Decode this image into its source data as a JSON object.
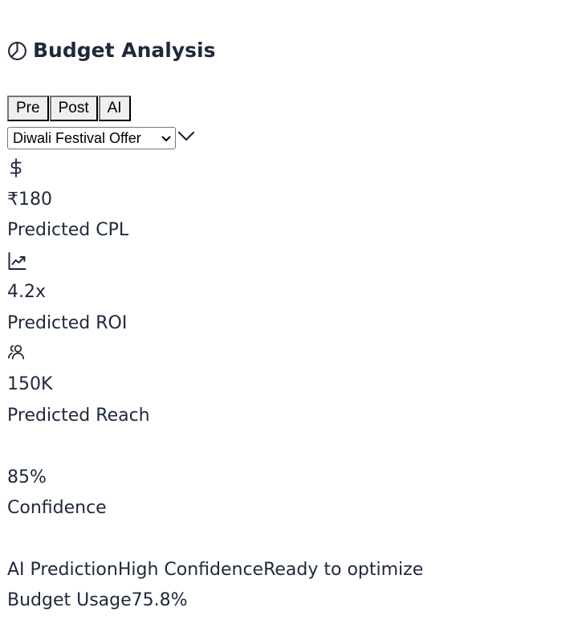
{
  "header": {
    "title": "Budget Analysis",
    "icon": "pie-chart-icon"
  },
  "tabs": [
    {
      "label": "Pre"
    },
    {
      "label": "Post"
    },
    {
      "label": "AI"
    }
  ],
  "campaign_select": {
    "selected": "Diwali Festival Offer"
  },
  "metrics": {
    "cpl": {
      "icon": "dollar-icon",
      "value": "₹180",
      "label": "Predicted CPL"
    },
    "roi": {
      "icon": "trending-up-icon",
      "value": "4.2x",
      "label": "Predicted ROI"
    },
    "reach": {
      "icon": "users-icon",
      "value": "150K",
      "label": "Predicted Reach"
    },
    "confidence": {
      "value": "85%",
      "label": "Confidence"
    }
  },
  "status_line": {
    "prediction": "AI Prediction",
    "confidence": "High Confidence",
    "ready": "Ready to optimize"
  },
  "budget": {
    "label": "Budget Usage",
    "value": "75.8%"
  }
}
